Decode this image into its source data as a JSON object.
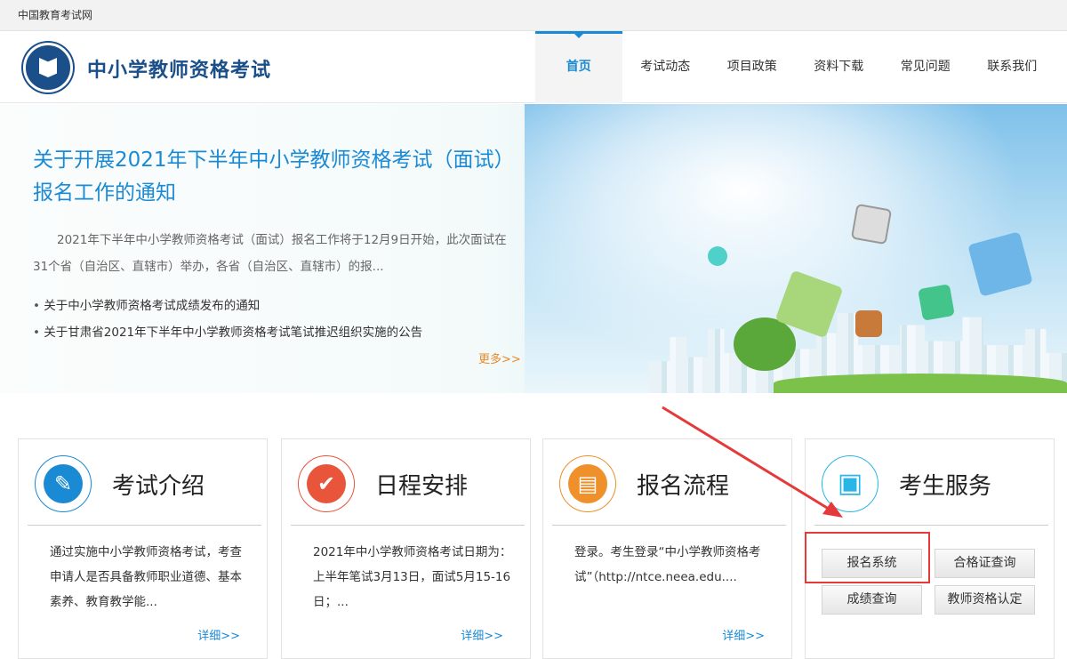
{
  "topbar": {
    "site_link": "中国教育考试网"
  },
  "header": {
    "title": "中小学教师资格考试",
    "nav": [
      "首页",
      "考试动态",
      "项目政策",
      "资料下载",
      "常见问题",
      "联系我们"
    ],
    "accent": "#1a8ad4"
  },
  "banner": {
    "title": "关于开展2021年下半年中小学教师资格考试（面试）报名工作的通知",
    "summary": "2021年下半年中小学教师资格考试（面试）报名工作将于12月9日开始，此次面试在31个省（自治区、直辖市）举办，各省（自治区、直辖市）的报...",
    "news": [
      "关于中小学教师资格考试成绩发布的通知",
      "关于甘肃省2021年下半年中小学教师资格考试笔试推迟组织实施的公告"
    ],
    "more": "更多>>"
  },
  "cards": [
    {
      "title": "考试介绍",
      "text": "通过实施中小学教师资格考试，考查申请人是否具备教师职业道德、基本素养、教育教学能...",
      "more": "详细>>",
      "color": "#1a8ad4"
    },
    {
      "title": "日程安排",
      "text": "2021年中小学教师资格考试日期为：上半年笔试3月13日，面试5月15-16日；...",
      "more": "详细>>",
      "color": "#e8553a"
    },
    {
      "title": "报名流程",
      "text": "登录。考生登录“中小学教师资格考试”（http://ntce.neea.edu....",
      "more": "详细>>",
      "color": "#f0902a"
    },
    {
      "title": "考生服务",
      "buttons": [
        "报名系统",
        "合格证查询",
        "成绩查询",
        "教师资格认定"
      ],
      "color": "#29b6e6"
    }
  ],
  "annotation_color": "#e53a3a"
}
